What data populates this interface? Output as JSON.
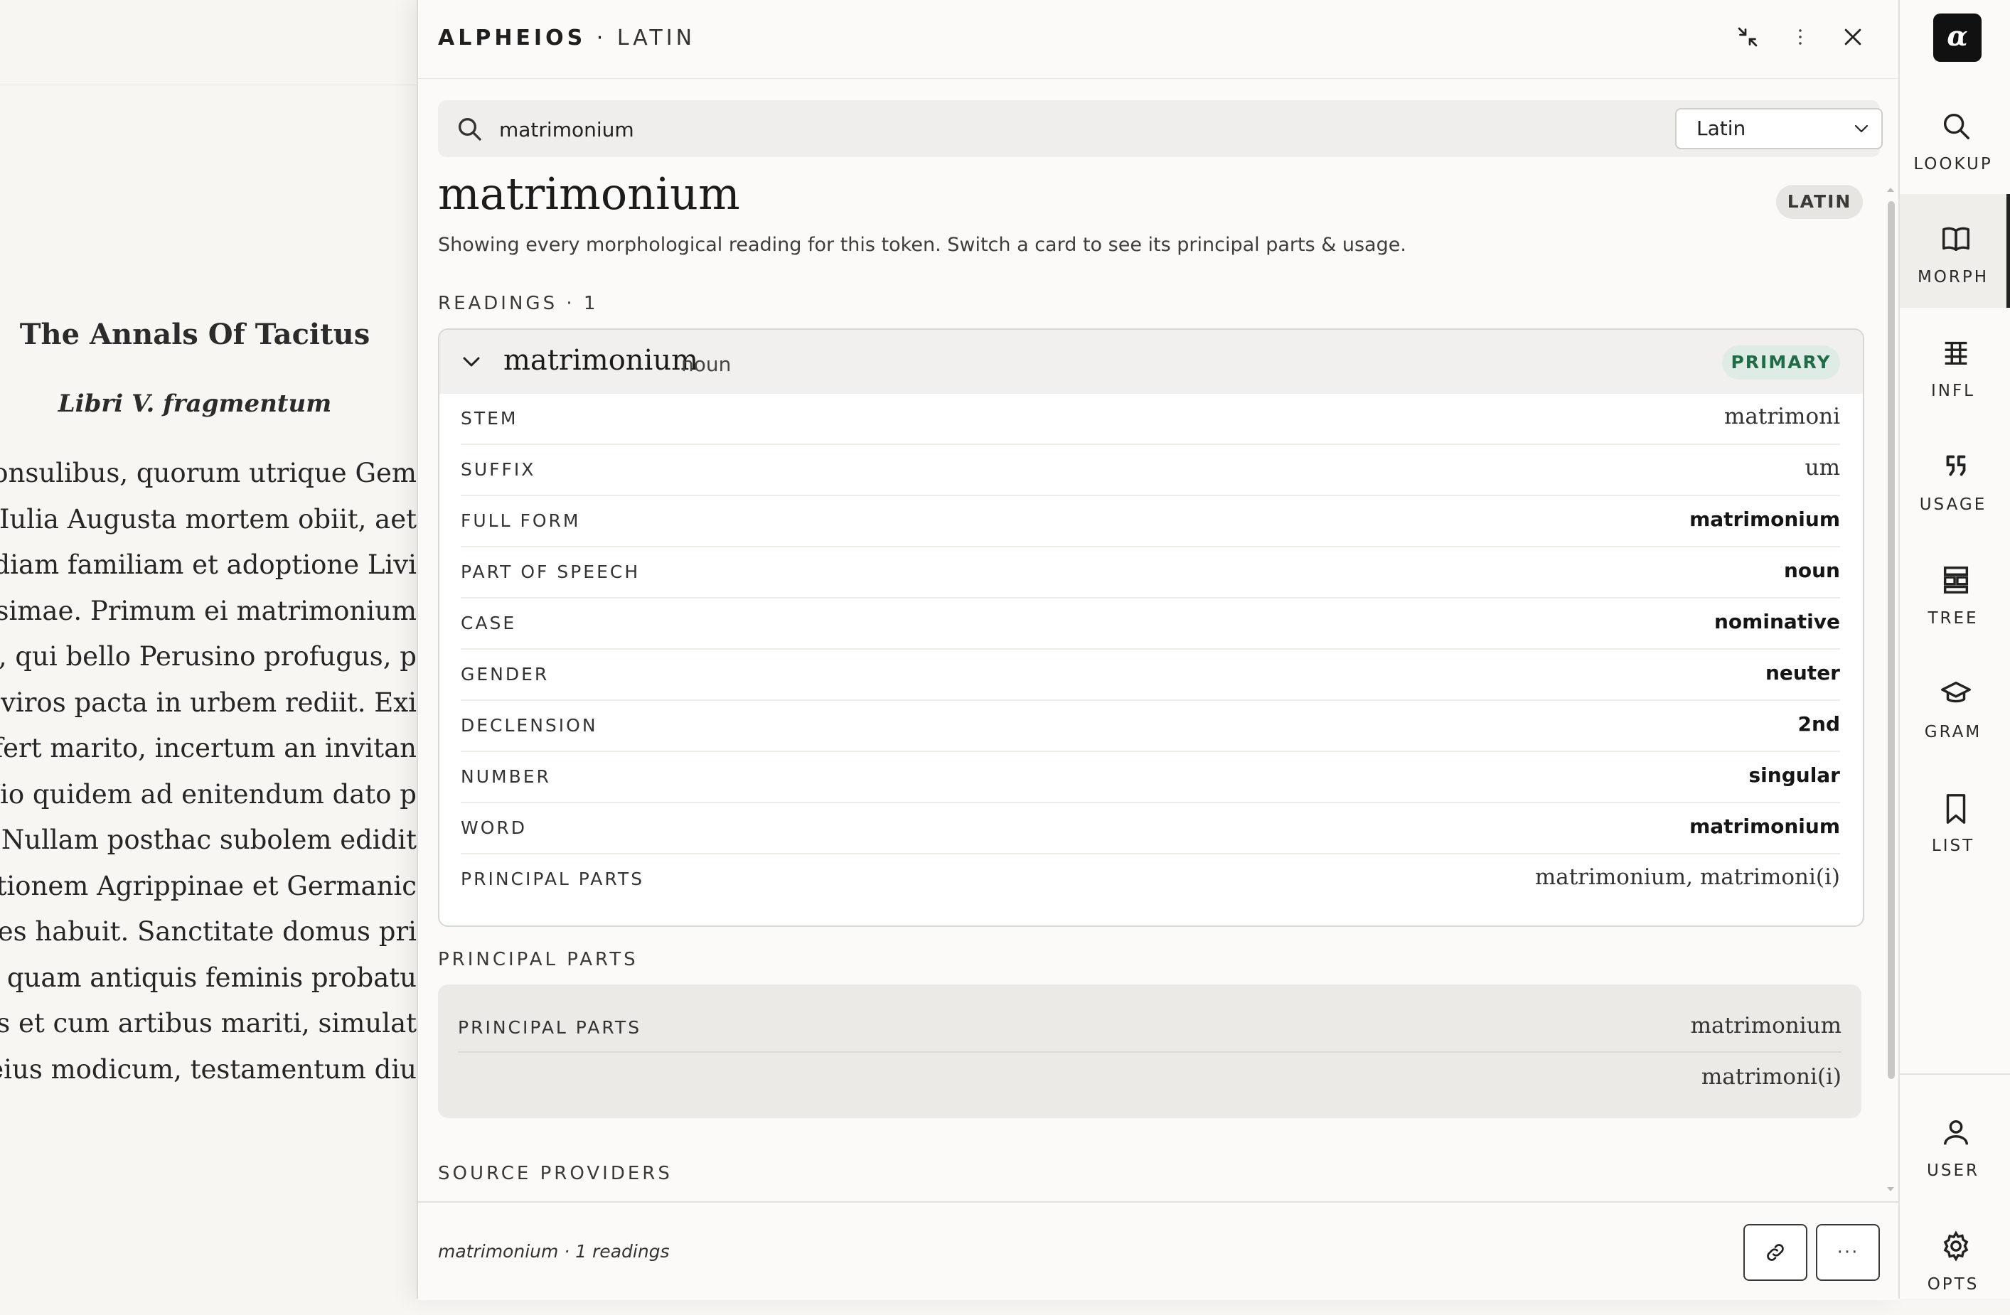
{
  "reader": {
    "title": "The Annals Of Tacitus",
    "subtitle": "Libri V. fragmentum",
    "lines": [
      "consulibus, quorum utrique Gem",
      "t, Iulia Augusta mortem obiit, aet",
      "udiam familiam et adoptione Livi",
      "ssimae. Primum ei matrimonium",
      "ne, qui bello Perusino profugus, p",
      "mviros pacta in urbem rediit. Exi",
      "ufert marito, incertum an invitan",
      "atio quidem ad enitendum dato p",
      "t. Nullam posthac subolem edidit",
      "nctionem Agrippinae et Germanic",
      "otes habuit. Sanctitate domus pri",
      "ra quam antiquis feminis probatu",
      "ilis et cum artibus mariti, simulat",
      "eius modicum, testamentum diu"
    ]
  },
  "header": {
    "brand": "ALPHEIOS",
    "separator": " · ",
    "language": "LATIN",
    "collapse_icon": "collapse-icon",
    "menu_icon": "kebab-menu-icon",
    "close_icon": "close-icon"
  },
  "search": {
    "value": "matrimonium",
    "placeholder": "",
    "language_selected": "Latin"
  },
  "entry": {
    "word": "matrimonium",
    "language_badge": "LATIN",
    "description": "Showing every morphological reading for this token. Switch a card to see its principal parts & usage.",
    "readings_label": "READINGS · 1"
  },
  "reading": {
    "lemma": "matrimonium",
    "pos": "noun",
    "badge": "PRIMARY",
    "features": [
      {
        "key": "STEM",
        "value": "matrimoni"
      },
      {
        "key": "SUFFIX",
        "value": "um"
      },
      {
        "key": "FULL FORM",
        "value": "matrimonium"
      },
      {
        "key": "PART OF SPEECH",
        "value": "noun"
      },
      {
        "key": "CASE",
        "value": "nominative"
      },
      {
        "key": "GENDER",
        "value": "neuter"
      },
      {
        "key": "DECLENSION",
        "value": "2nd"
      },
      {
        "key": "NUMBER",
        "value": "singular"
      },
      {
        "key": "WORD",
        "value": "matrimonium"
      },
      {
        "key": "PRINCIPAL PARTS",
        "value": "matrimonium, matrimoni(i)"
      }
    ]
  },
  "principal_parts": {
    "label": "PRINCIPAL PARTS",
    "row_label": "PRINCIPAL PARTS",
    "values": [
      "matrimonium",
      "matrimoni(i)"
    ]
  },
  "source_providers": {
    "label": "SOURCE PROVIDERS"
  },
  "footer": {
    "summary": "matrimonium · 1 readings",
    "link_icon": "link-icon",
    "more_label": "···"
  },
  "rail": {
    "logo": "α",
    "items": [
      {
        "label": "LOOKUP",
        "icon": "search-icon"
      },
      {
        "label": "MORPH",
        "icon": "book-icon"
      },
      {
        "label": "INFL",
        "icon": "table-icon"
      },
      {
        "label": "USAGE",
        "icon": "quote-icon"
      },
      {
        "label": "TREE",
        "icon": "tree-icon"
      },
      {
        "label": "GRAM",
        "icon": "graduation-cap-icon"
      },
      {
        "label": "LIST",
        "icon": "bookmark-icon"
      }
    ],
    "bottom_items": [
      {
        "label": "USER",
        "icon": "user-icon"
      },
      {
        "label": "OPTS",
        "icon": "gear-icon"
      }
    ]
  },
  "colors": {
    "accent_green": "#226b47",
    "primary_badge_bg": "#dfece5",
    "background": "#f7f6f3"
  }
}
